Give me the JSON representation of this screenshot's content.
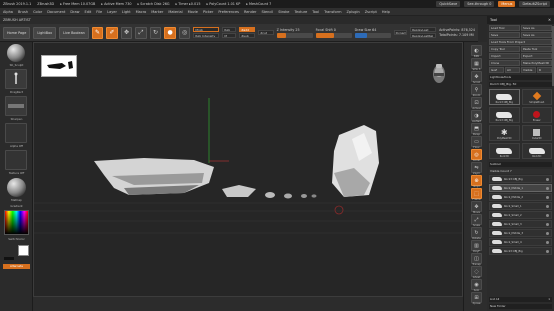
{
  "titlebar": {
    "app_title": "ZBrush 2019.1.1",
    "doc": "ZBrush3D",
    "stats": [
      "▸ Free Mem 10.07GB",
      "▸ Active Mem 730",
      "▸ Scratch Disk 26G",
      "▸ Timer ▸0.015",
      "▸ PolyCount 1.01 KP",
      "▸ MeshCount 7"
    ],
    "quicksave_label": "QuickSave",
    "seethrough_label": "See-through",
    "seethrough_value": "0",
    "menus_label": "Menus",
    "default_script_label": "DefaultZScript"
  },
  "menubar": {
    "items": [
      "Alpha",
      "Brush",
      "Color",
      "Document",
      "Draw",
      "Edit",
      "File",
      "Layer",
      "Light",
      "Macro",
      "Marker",
      "Material",
      "Movie",
      "Picker",
      "Preferences",
      "Render",
      "Stencil",
      "Stroke",
      "Texture",
      "Tool",
      "Transform",
      "Zplugin",
      "Zscript",
      "Help"
    ]
  },
  "brand": {
    "label": "ZBRUSH ARTIST"
  },
  "toolbar": {
    "home_page": "Home Page",
    "lightbox": "LightBox",
    "live_boolean": "Live Boolean",
    "edit": "Edit",
    "draw": "Draw",
    "move": "Move",
    "scale": "Scale",
    "rotate": "Rotate",
    "mrgb": "Mrgb",
    "rgb": "Rgb",
    "m": "M",
    "zadd": "Zadd",
    "zsub": "Zsub",
    "zcut": "Zcut",
    "rgb_intensity": "Rgb Intensity",
    "z_intensity": "Z Intensity 25",
    "focal_shift": "Focal Shift 0",
    "draw_size": "Draw Size 64",
    "dynamic": "Dynamic",
    "replay_last": "ReplayLast",
    "replay_last_rel": "ReplayLastRel",
    "active_points": "ActivePoints: 876,524",
    "total_points": "TotalPoints: 7.109 Mil",
    "z_intensity_fill": 0.25,
    "draw_size_fill": 0.35,
    "focal_fill": 0.5
  },
  "leftshelf": {
    "items": [
      {
        "label": "SK_Sculpt"
      },
      {
        "label": "DragRect"
      },
      {
        "label": "Sharpen"
      },
      {
        "label": "Alpha Off"
      },
      {
        "label": "Texture Off"
      },
      {
        "label": "MatCap"
      }
    ],
    "gradient_label": "Gradient",
    "switch_color_label": "SwitchColor",
    "alternate_label": "Alternate",
    "accent": "#d7701e"
  },
  "rightshelf": {
    "items": [
      {
        "label": "BPR",
        "icon": "bpr-icon"
      },
      {
        "label": "SPix 3",
        "icon": "spix-icon"
      },
      {
        "label": "Scroll",
        "icon": "scroll-icon"
      },
      {
        "label": "Zoom",
        "icon": "zoom-icon"
      },
      {
        "label": "Actual",
        "icon": "actual-icon"
      },
      {
        "label": "AAHalf",
        "icon": "aahalf-icon"
      },
      {
        "label": "Persp",
        "icon": "persp-icon"
      },
      {
        "label": "Floor",
        "icon": "floor-icon"
      },
      {
        "label": "Local",
        "icon": "local-icon"
      },
      {
        "label": "LSym",
        "icon": "lsym-icon"
      },
      {
        "label": "Gxyz",
        "icon": "gxyz-icon"
      },
      {
        "label": "Frame",
        "icon": "frame-icon"
      },
      {
        "label": "Move",
        "icon": "move-icon"
      },
      {
        "label": "Scale",
        "icon": "scale-icon"
      },
      {
        "label": "Rotate",
        "icon": "rotate-icon"
      },
      {
        "label": "PolyF",
        "icon": "polyf-icon"
      },
      {
        "label": "Transp",
        "icon": "transp-icon"
      },
      {
        "label": "Ghost",
        "icon": "ghost-icon"
      },
      {
        "label": "Solo",
        "icon": "solo-icon"
      },
      {
        "label": "Xpose",
        "icon": "xpose-icon"
      }
    ]
  },
  "toolpanel": {
    "title": "Tool",
    "rows": [
      [
        "Load Tool",
        "Save As"
      ],
      [
        "Save",
        "Save As"
      ],
      [
        "Load Tools From Project"
      ],
      [
        "Copy Tool",
        "Paste Tool"
      ],
      [
        "Import",
        "Export"
      ],
      [
        "Clone",
        "Make PolyMesh3D"
      ],
      [
        "GoZ",
        "All",
        "Visible",
        "R"
      ]
    ],
    "lightbox_tools": "Lightbox▸Tools",
    "current_tool": "Rock3 OBJ_Big. 50",
    "thumbs": [
      {
        "caption": "Rock3 OBJ_Big",
        "kind": "rock"
      },
      {
        "caption": "SimpleBrush",
        "kind": "brush"
      },
      {
        "caption": "Rock3 OBJ_Big",
        "kind": "rock"
      },
      {
        "caption": "Eraser",
        "kind": "eraser"
      },
      {
        "caption": "PolyMesh3D",
        "kind": "star"
      },
      {
        "caption": "Cube3D",
        "kind": "cube"
      },
      {
        "caption": "Rock3D",
        "kind": "rock"
      },
      {
        "caption": "Rock3D",
        "kind": "rock"
      }
    ],
    "subtool_header": "Subtool",
    "visible_count": "Visible Count 7",
    "subtools": [
      "Rock3 OBJ_Big",
      "Rock_Middle_1",
      "Rock_Middle_2",
      "Rock_Small_1",
      "Rock_Small_2",
      "Rock_Small_3",
      "Rock_Middle_3",
      "Rock_Small_4",
      "Rock3 OBJ_Big"
    ],
    "active_subtool_index": 1,
    "list_all": "List All",
    "new_folder": "New Folder",
    "footer_value": "1"
  }
}
